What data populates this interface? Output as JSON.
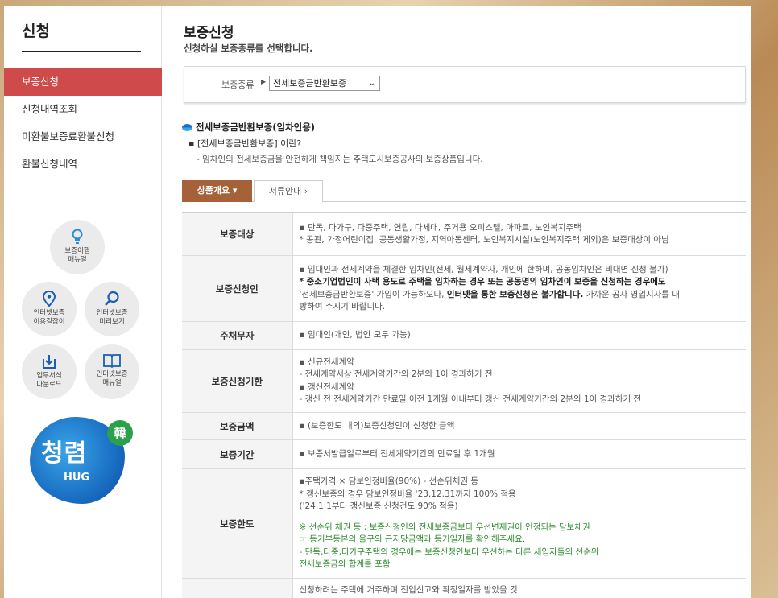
{
  "sidebar": {
    "title": "신청",
    "menu": [
      {
        "label": "보증신청",
        "active": true
      },
      {
        "label": "신청내역조회",
        "active": false
      },
      {
        "label": "미환불보증료환불신청",
        "active": false
      },
      {
        "label": "환불신청내역",
        "active": false
      }
    ],
    "quick_links": [
      {
        "label1": "보증이행",
        "label2": "매뉴얼",
        "icon": "lightbulb-icon"
      },
      {
        "label1": "인터넷보증",
        "label2": "이용길잡이",
        "icon": "map-pin-icon"
      },
      {
        "label1": "인터넷보증",
        "label2": "미리보기",
        "icon": "magnifier-icon"
      },
      {
        "label1": "업무서식",
        "label2": "다운로드",
        "icon": "download-icon"
      },
      {
        "label1": "인터넷보증",
        "label2": "매뉴얼",
        "icon": "book-icon"
      }
    ],
    "logo": {
      "script": "청렴",
      "text": "HUG",
      "badge": "韓"
    }
  },
  "main": {
    "title": "보증신청",
    "subtitle": "신청하실 보증종류를 선택합니다.",
    "select": {
      "label": "보증종류",
      "value": "전세보증금반환보증"
    },
    "product": {
      "heading": "전세보증금반환보증(임차인용)",
      "question": "[전세보증금반환보증] 이란?",
      "description": "- 임차인의 전세보증금을 안전하게 책임지는 주택도시보증공사의 보증상품입니다."
    },
    "tabs": [
      {
        "label": "상품개요 ▾",
        "active": true
      },
      {
        "label": "서류안내 ›",
        "active": false
      }
    ],
    "table": {
      "rows": [
        {
          "header": "보증대상",
          "lines": [
            "▪ 단독, 다가구, 다중주택, 연립, 다세대, 주거용 오피스텔, 아파트, 노인복지주택",
            "* 공관, 가정어린이집, 공동생활가정, 지역아동센터, 노인복지시설(노인복지주택 제외)은 보증대상이 아님"
          ]
        },
        {
          "header": "보증신청인",
          "lines": [
            "▪ 임대인과 전세계약을 체결한 임차인(전세, 월세계약자, 개인에 한하며, 공동임차인은 비대면 신청 불가)"
          ],
          "bold_line": "* 중소기업법인이 사택 용도로 주택을 임차하는 경우 또는 공동명의 임차인이 보증을 신청하는 경우에도",
          "mixed_line_a": "'전세보증금반환보증' 가입이 가능하오나, ",
          "mixed_line_b": "인터넷을 통한 보증신청은 불가합니다.",
          "mixed_line_c": " 가까운 공사 영업지사를 내",
          "last_line": "방하여 주시기 바랍니다."
        },
        {
          "header": "주채무자",
          "lines": [
            "▪ 임대인(개인, 법인 모두 가능)"
          ]
        },
        {
          "header": "보증신청기한",
          "lines": [
            "▪ 신규전세계약",
            "  - 전세계약서상 전세계약기간의 2분의 1이 경과하기 전",
            "▪ 갱신전세계약",
            "  - 갱신 전 전세계약기간 만료일 이전 1개월 이내부터 갱신 전세계약기간의 2분의 1이 경과하기 전"
          ]
        },
        {
          "header": "보증금액",
          "lines": [
            "▪ (보증한도 내의)보증신청인이 신청한 금액"
          ]
        },
        {
          "header": "보증기간",
          "lines": [
            "▪ 보증서발급일로부터 전세계약기간의 만료일 후 1개월"
          ]
        },
        {
          "header": "보증한도",
          "lines": [
            "▪주택가격 × 담보인정비율(90%) - 선순위채권 등",
            "  * 갱신보증의 경우 담보인정비율 '23.12.31까지 100% 적용",
            "  ('24.1.1부터 갱신보증 신청건도 90% 적용)"
          ],
          "green_lines": [
            "※ 선순위 채권 등 : 보증신청인의 전세보증금보다 우선변제권이 인정되는 담보채권",
            "  ☞ 등기부등본의 을구의 근저당금액과 등기일자를 확인해주세요.",
            "  - 단독,다중,다가구주택의 경우에는 보증신청인보다 우선하는 다른 세입자들의 선순위",
            "  전세보증금의 합계를 포함"
          ]
        },
        {
          "header": "",
          "lines": [
            "신청하려는 주택에 거주하며 전입신고와 확정일자를 받았을 것"
          ]
        }
      ]
    }
  },
  "colors": {
    "active_menu": "#cf4a4b",
    "active_tab": "#a56137",
    "green_note": "#2e8a2e",
    "logo_blue": "#1a6fc4"
  }
}
